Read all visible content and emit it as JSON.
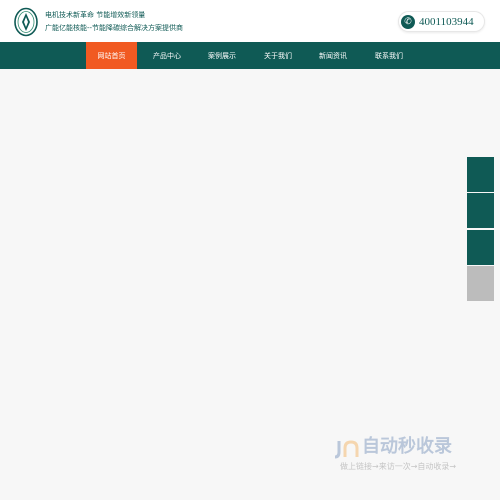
{
  "header": {
    "tagline_1": "电机技术新革命 节能增效新领量",
    "tagline_2": "广能亿能核能--节能降碳综合解决方案提供商",
    "hotline": "4001103944",
    "logo_icon": "company-logo-icon",
    "phone_icon": "phone-icon"
  },
  "nav": {
    "items": [
      {
        "label": "网站首页",
        "active": true
      },
      {
        "label": "产品中心",
        "active": false
      },
      {
        "label": "案例展示",
        "active": false
      },
      {
        "label": "关于我们",
        "active": false
      },
      {
        "label": "新闻资讯",
        "active": false
      },
      {
        "label": "联系我们",
        "active": false
      }
    ]
  },
  "side_toolbar": {
    "buttons": [
      "teal",
      "teal",
      "teal",
      "gray"
    ]
  },
  "watermark": {
    "title": "自动秒收录",
    "subtitle": "做上链接→来访一次→自动收录→"
  },
  "colors": {
    "brand": "#0f5a55",
    "accent": "#f15a22",
    "background": "#f7f7f7",
    "side_gray": "#bcbcbc"
  }
}
